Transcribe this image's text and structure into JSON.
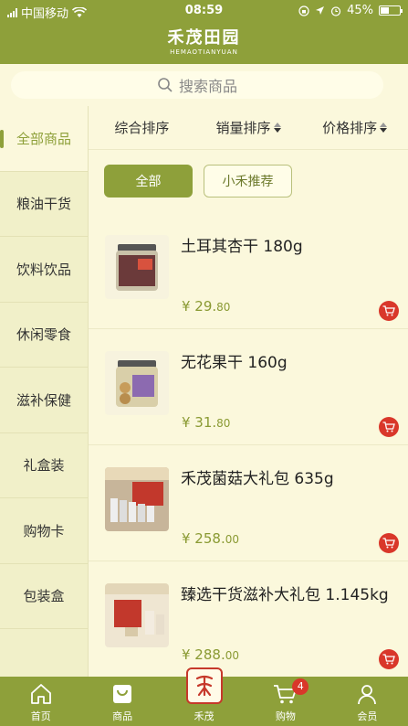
{
  "status_bar": {
    "carrier": "中国移动",
    "time": "08:59",
    "battery": "45%"
  },
  "header": {
    "logo_cn": "禾茂田园",
    "logo_en": "HEMAOTIANYUAN"
  },
  "search": {
    "placeholder": "搜索商品"
  },
  "sidebar": {
    "items": [
      {
        "label": "全部商品",
        "active": true
      },
      {
        "label": "粮油干货"
      },
      {
        "label": "饮料饮品"
      },
      {
        "label": "休闲零食"
      },
      {
        "label": "滋补保健"
      },
      {
        "label": "礼盒装"
      },
      {
        "label": "购物卡"
      },
      {
        "label": "包装盒"
      }
    ]
  },
  "sort": {
    "overall": "综合排序",
    "sales": "销量排序",
    "price": "价格排序"
  },
  "filter": {
    "all": "全部",
    "recommend": "小禾推荐"
  },
  "products": [
    {
      "name": "土耳其杏干  180g",
      "price_int": "¥ 29.",
      "price_dec": "80"
    },
    {
      "name": "无花果干  160g",
      "price_int": "¥ 31.",
      "price_dec": "80"
    },
    {
      "name": "禾茂菌菇大礼包 635g",
      "price_int": "¥ 258.",
      "price_dec": "00"
    },
    {
      "name": "臻选干货滋补大礼包 1.145kg",
      "price_int": "¥ 288.",
      "price_dec": "00"
    }
  ],
  "tabbar": {
    "home": "首页",
    "goods": "商品",
    "brand": "禾茂",
    "cart": "购物",
    "cart_badge": "4",
    "member": "会员"
  },
  "colors": {
    "brand": "#8ea03a",
    "accent_red": "#d9372a",
    "background": "#fbf8dc"
  }
}
